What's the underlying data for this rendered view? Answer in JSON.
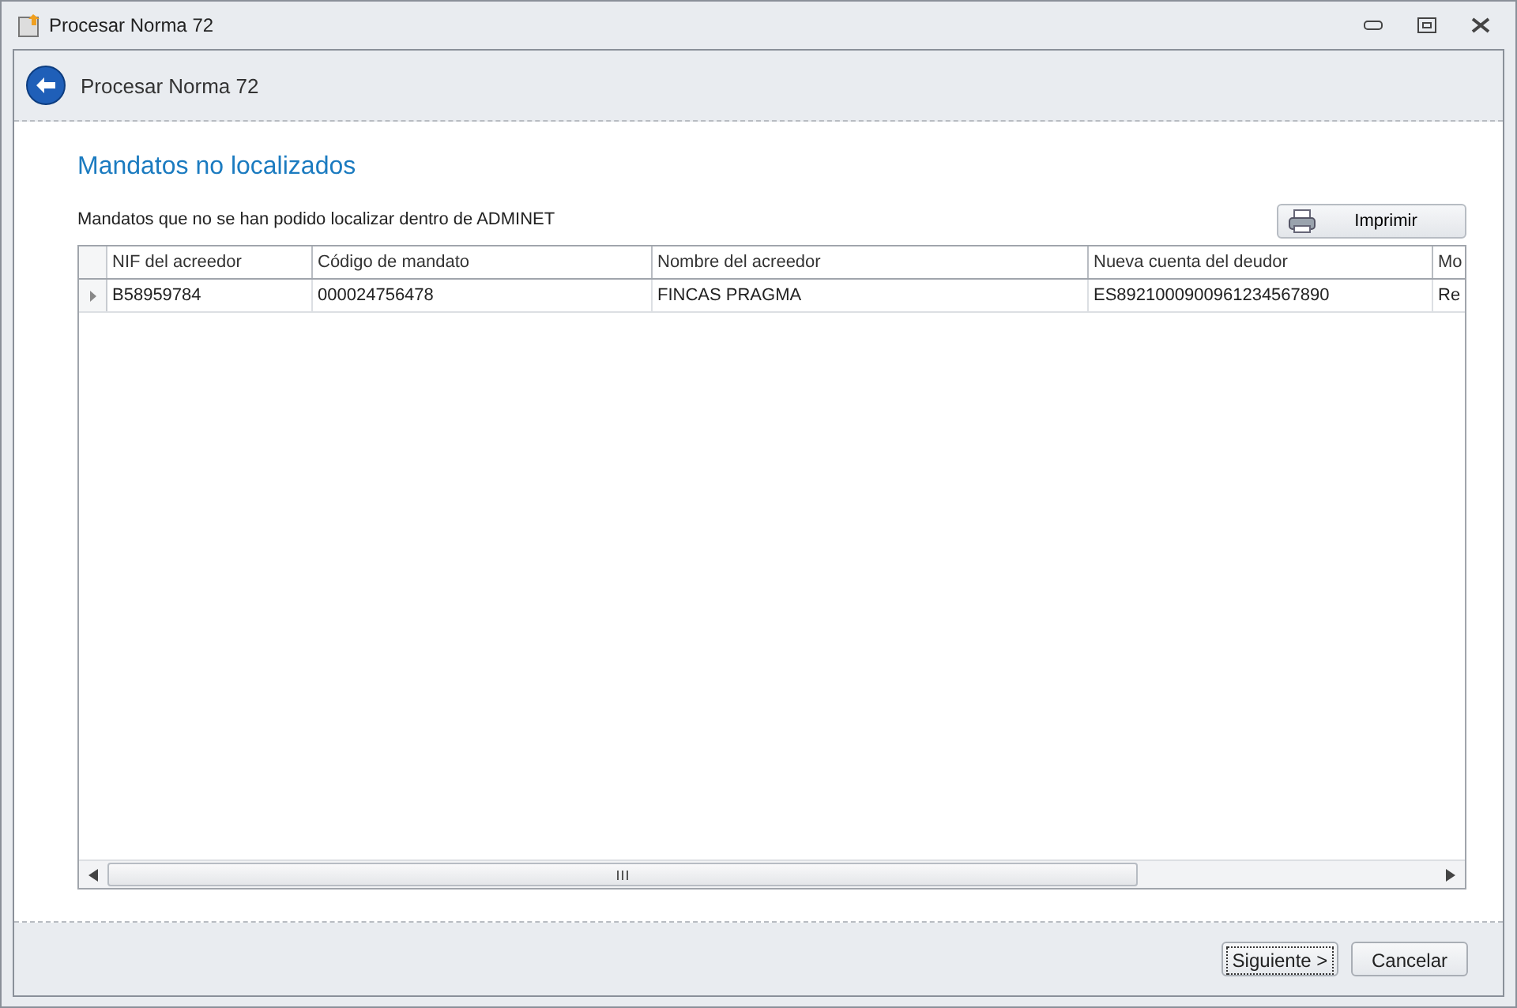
{
  "window": {
    "title": "Procesar Norma 72"
  },
  "header": {
    "title": "Procesar Norma 72"
  },
  "section_title": "Mandatos no localizados",
  "description": "Mandatos que no se han podido localizar dentro de ADMINET",
  "print_button": "Imprimir",
  "table": {
    "columns": [
      "NIF del acreedor",
      "Código de mandato",
      "Nombre del acreedor",
      "Nueva cuenta del deudor",
      "Mo"
    ],
    "rows": [
      {
        "selected": true,
        "cells": [
          "B58959784",
          "000024756478",
          "FINCAS PRAGMA",
          "ES8921000900961234567890",
          "Re"
        ]
      }
    ]
  },
  "buttons": [
    {
      "label": "Siguiente >",
      "focused": true
    },
    {
      "label": "Cancelar",
      "focused": false
    }
  ]
}
